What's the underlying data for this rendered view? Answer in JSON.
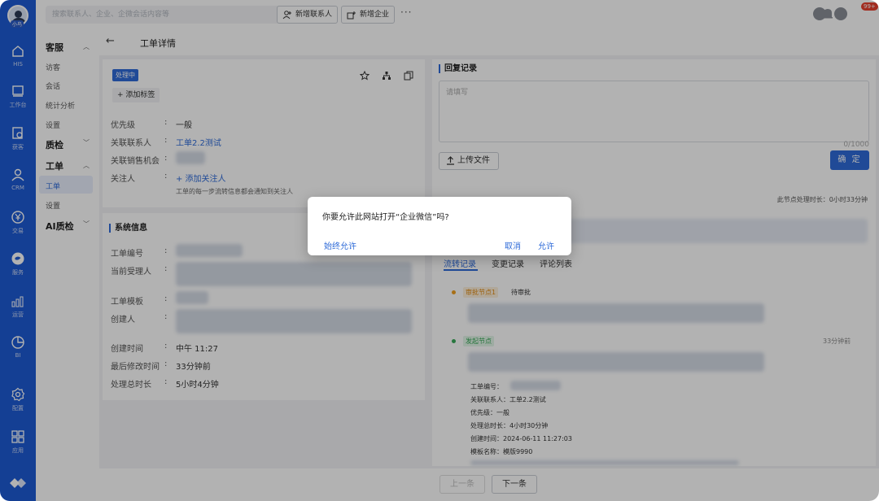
{
  "rail": {
    "avatar_tag": "小鸟",
    "items": [
      {
        "label": "HIS",
        "icon": "home-icon"
      },
      {
        "label": "工作台",
        "icon": "workbench-icon"
      },
      {
        "label": "获客",
        "icon": "acquire-icon"
      },
      {
        "label": "CRM",
        "icon": "user-icon"
      },
      {
        "label": "交易",
        "icon": "yen-icon"
      },
      {
        "label": "服务",
        "icon": "chat-icon"
      },
      {
        "label": "运营",
        "icon": "operations-icon"
      },
      {
        "label": "BI",
        "icon": "pie-chart-icon"
      },
      {
        "label": "配置",
        "icon": "gear-icon"
      },
      {
        "label": "应用",
        "icon": "apps-icon"
      }
    ]
  },
  "topbar": {
    "search_placeholder": "搜索联系人、企业、企微会话内容等",
    "new_contact": "新增联系人",
    "new_company": "新增企业",
    "more": "···",
    "badge": "99+"
  },
  "subnav": {
    "groups": [
      {
        "label": "客服",
        "items": [
          "访客",
          "会话",
          "统计分析",
          "设置"
        ]
      },
      {
        "label": "质检"
      },
      {
        "label": "工单",
        "items": [
          "工单",
          "设置"
        ]
      },
      {
        "label": "AI质检"
      }
    ]
  },
  "page": {
    "back": "←",
    "title": "工单详情"
  },
  "ticket": {
    "status": "处理中",
    "add_tag": "+ 添加标签",
    "fields": [
      {
        "label": "优先级",
        "value": "一般"
      },
      {
        "label": "关联联系人",
        "value": "工单2.2测试"
      },
      {
        "label": "关联销售机会",
        "value": ""
      },
      {
        "label": "关注人",
        "value": "+ 添加关注人"
      }
    ],
    "watch_hint": "工单的每一步流转信息都会通知到关注人",
    "colon": ":"
  },
  "system": {
    "title": "系统信息",
    "fields": [
      {
        "label": "工单编号",
        "value": ""
      },
      {
        "label": "当前受理人",
        "value": ""
      },
      {
        "label": "工单模板",
        "value": ""
      },
      {
        "label": "创建人",
        "value": ""
      },
      {
        "label": "创建时间",
        "value": "中午 11:27"
      },
      {
        "label": "最后修改时间",
        "value": "33分钟前"
      },
      {
        "label": "处理总时长",
        "value": "5小时4分钟"
      }
    ]
  },
  "reply": {
    "title": "回复记录",
    "placeholder": "请填写",
    "counter": "0/1000",
    "upload": "上传文件",
    "confirm": "确 定",
    "node_duration": "此节点处理时长：0小时33分钟"
  },
  "tabs": [
    "流转记录",
    "变更记录",
    "评论列表"
  ],
  "flow": {
    "node1": {
      "tag": "审批节点1",
      "status": "待审批"
    },
    "node2": {
      "tag": "发起节点",
      "time": "33分钟前"
    },
    "details": [
      "工单编号：",
      "关联联系人：工单2.2测试",
      "优先级：一般",
      "处理总时长：4小时30分钟",
      "创建时间：2024-06-11 11:27:03",
      "模板名称：模版9990"
    ]
  },
  "footer": {
    "prev": "上一条",
    "next": "下一条"
  },
  "dialog": {
    "message": "你要允许此网站打开“企业微信”吗?",
    "always": "始终允许",
    "cancel": "取消",
    "allow": "允许"
  }
}
